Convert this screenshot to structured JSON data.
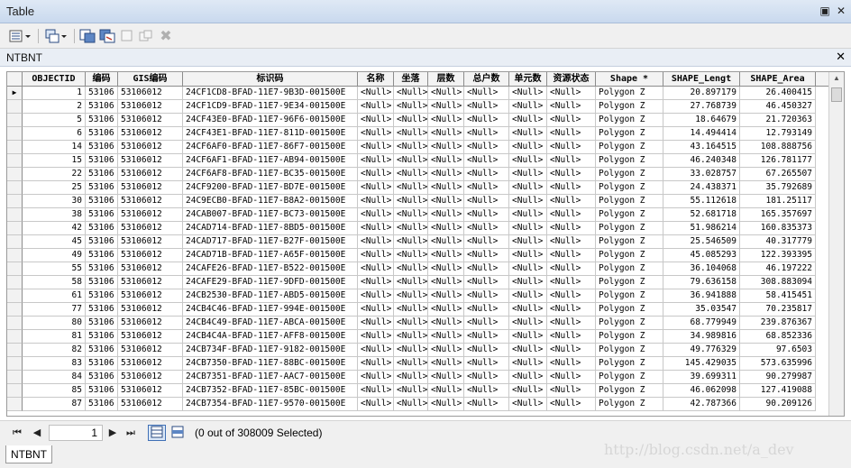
{
  "window": {
    "title": "Table"
  },
  "layer": {
    "name": "NTBNT"
  },
  "table": {
    "columns": [
      "OBJECTID",
      "编码",
      "GIS编码",
      "标识码",
      "名称",
      "坐落",
      "层数",
      "总户数",
      "单元数",
      "资源状态",
      "Shape *",
      "SHAPE_Lengt",
      "SHAPE_Area"
    ],
    "rows": [
      [
        "1",
        "53106",
        "53106012",
        "24CF1CD8-BFAD-11E7-9B3D-001500E",
        "<Null>",
        "<Null>",
        "<Null>",
        "<Null>",
        "<Null>",
        "<Null>",
        "Polygon Z",
        "20.897179",
        "26.400415"
      ],
      [
        "2",
        "53106",
        "53106012",
        "24CF1CD9-BFAD-11E7-9E34-001500E",
        "<Null>",
        "<Null>",
        "<Null>",
        "<Null>",
        "<Null>",
        "<Null>",
        "Polygon Z",
        "27.768739",
        "46.450327"
      ],
      [
        "5",
        "53106",
        "53106012",
        "24CF43E0-BFAD-11E7-96F6-001500E",
        "<Null>",
        "<Null>",
        "<Null>",
        "<Null>",
        "<Null>",
        "<Null>",
        "Polygon Z",
        "18.64679",
        "21.720363"
      ],
      [
        "6",
        "53106",
        "53106012",
        "24CF43E1-BFAD-11E7-811D-001500E",
        "<Null>",
        "<Null>",
        "<Null>",
        "<Null>",
        "<Null>",
        "<Null>",
        "Polygon Z",
        "14.494414",
        "12.793149"
      ],
      [
        "14",
        "53106",
        "53106012",
        "24CF6AF0-BFAD-11E7-86F7-001500E",
        "<Null>",
        "<Null>",
        "<Null>",
        "<Null>",
        "<Null>",
        "<Null>",
        "Polygon Z",
        "43.164515",
        "108.888756"
      ],
      [
        "15",
        "53106",
        "53106012",
        "24CF6AF1-BFAD-11E7-AB94-001500E",
        "<Null>",
        "<Null>",
        "<Null>",
        "<Null>",
        "<Null>",
        "<Null>",
        "Polygon Z",
        "46.240348",
        "126.781177"
      ],
      [
        "22",
        "53106",
        "53106012",
        "24CF6AF8-BFAD-11E7-BC35-001500E",
        "<Null>",
        "<Null>",
        "<Null>",
        "<Null>",
        "<Null>",
        "<Null>",
        "Polygon Z",
        "33.028757",
        "67.265507"
      ],
      [
        "25",
        "53106",
        "53106012",
        "24CF9200-BFAD-11E7-BD7E-001500E",
        "<Null>",
        "<Null>",
        "<Null>",
        "<Null>",
        "<Null>",
        "<Null>",
        "Polygon Z",
        "24.438371",
        "35.792689"
      ],
      [
        "30",
        "53106",
        "53106012",
        "24C9ECB0-BFAD-11E7-B8A2-001500E",
        "<Null>",
        "<Null>",
        "<Null>",
        "<Null>",
        "<Null>",
        "<Null>",
        "Polygon Z",
        "55.112618",
        "181.25117"
      ],
      [
        "38",
        "53106",
        "53106012",
        "24CAB007-BFAD-11E7-BC73-001500E",
        "<Null>",
        "<Null>",
        "<Null>",
        "<Null>",
        "<Null>",
        "<Null>",
        "Polygon Z",
        "52.681718",
        "165.357697"
      ],
      [
        "42",
        "53106",
        "53106012",
        "24CAD714-BFAD-11E7-8BD5-001500E",
        "<Null>",
        "<Null>",
        "<Null>",
        "<Null>",
        "<Null>",
        "<Null>",
        "Polygon Z",
        "51.986214",
        "160.835373"
      ],
      [
        "45",
        "53106",
        "53106012",
        "24CAD717-BFAD-11E7-B27F-001500E",
        "<Null>",
        "<Null>",
        "<Null>",
        "<Null>",
        "<Null>",
        "<Null>",
        "Polygon Z",
        "25.546509",
        "40.317779"
      ],
      [
        "49",
        "53106",
        "53106012",
        "24CAD71B-BFAD-11E7-A65F-001500E",
        "<Null>",
        "<Null>",
        "<Null>",
        "<Null>",
        "<Null>",
        "<Null>",
        "Polygon Z",
        "45.085293",
        "122.393395"
      ],
      [
        "55",
        "53106",
        "53106012",
        "24CAFE26-BFAD-11E7-B522-001500E",
        "<Null>",
        "<Null>",
        "<Null>",
        "<Null>",
        "<Null>",
        "<Null>",
        "Polygon Z",
        "36.104068",
        "46.197222"
      ],
      [
        "58",
        "53106",
        "53106012",
        "24CAFE29-BFAD-11E7-9DFD-001500E",
        "<Null>",
        "<Null>",
        "<Null>",
        "<Null>",
        "<Null>",
        "<Null>",
        "Polygon Z",
        "79.636158",
        "308.883094"
      ],
      [
        "61",
        "53106",
        "53106012",
        "24CB2530-BFAD-11E7-ABD5-001500E",
        "<Null>",
        "<Null>",
        "<Null>",
        "<Null>",
        "<Null>",
        "<Null>",
        "Polygon Z",
        "36.941888",
        "58.415451"
      ],
      [
        "77",
        "53106",
        "53106012",
        "24CB4C46-BFAD-11E7-994E-001500E",
        "<Null>",
        "<Null>",
        "<Null>",
        "<Null>",
        "<Null>",
        "<Null>",
        "Polygon Z",
        "35.03547",
        "70.235817"
      ],
      [
        "80",
        "53106",
        "53106012",
        "24CB4C49-BFAD-11E7-ABCA-001500E",
        "<Null>",
        "<Null>",
        "<Null>",
        "<Null>",
        "<Null>",
        "<Null>",
        "Polygon Z",
        "68.779949",
        "239.876367"
      ],
      [
        "81",
        "53106",
        "53106012",
        "24CB4C4A-BFAD-11E7-AFF8-001500E",
        "<Null>",
        "<Null>",
        "<Null>",
        "<Null>",
        "<Null>",
        "<Null>",
        "Polygon Z",
        "34.989816",
        "68.852336"
      ],
      [
        "82",
        "53106",
        "53106012",
        "24CB734F-BFAD-11E7-9182-001500E",
        "<Null>",
        "<Null>",
        "<Null>",
        "<Null>",
        "<Null>",
        "<Null>",
        "Polygon Z",
        "49.776329",
        "97.6503"
      ],
      [
        "83",
        "53106",
        "53106012",
        "24CB7350-BFAD-11E7-88BC-001500E",
        "<Null>",
        "<Null>",
        "<Null>",
        "<Null>",
        "<Null>",
        "<Null>",
        "Polygon Z",
        "145.429035",
        "573.635996"
      ],
      [
        "84",
        "53106",
        "53106012",
        "24CB7351-BFAD-11E7-AAC7-001500E",
        "<Null>",
        "<Null>",
        "<Null>",
        "<Null>",
        "<Null>",
        "<Null>",
        "Polygon Z",
        "39.699311",
        "90.279987"
      ],
      [
        "85",
        "53106",
        "53106012",
        "24CB7352-BFAD-11E7-85BC-001500E",
        "<Null>",
        "<Null>",
        "<Null>",
        "<Null>",
        "<Null>",
        "<Null>",
        "Polygon Z",
        "46.062098",
        "127.419088"
      ],
      [
        "87",
        "53106",
        "53106012",
        "24CB7354-BFAD-11E7-9570-001500E",
        "<Null>",
        "<Null>",
        "<Null>",
        "<Null>",
        "<Null>",
        "<Null>",
        "Polygon Z",
        "42.787366",
        "90.209126"
      ]
    ]
  },
  "nav": {
    "page": "1"
  },
  "status": {
    "text": "(0 out of 308009 Selected)"
  },
  "tabs": [
    "NTBNT"
  ],
  "watermark": "http://blog.csdn.net/a_dev",
  "icons": {
    "close": "close-icon",
    "restore": "restore-icon",
    "table_options": "table-options-icon",
    "related_tables": "related-tables-icon"
  }
}
